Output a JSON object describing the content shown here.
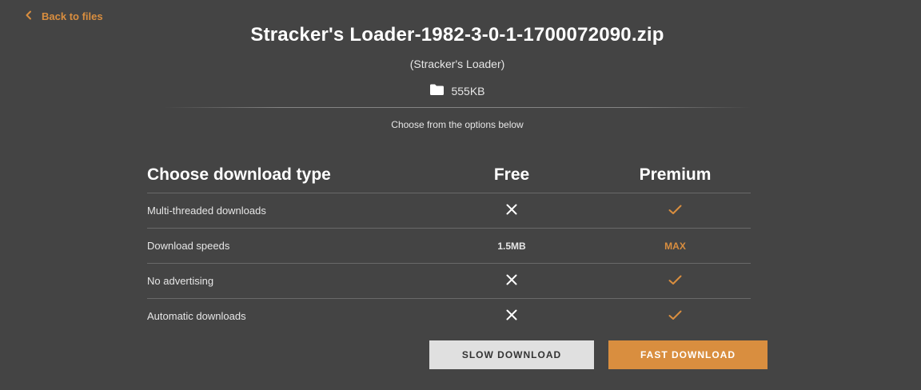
{
  "nav": {
    "back_label": "Back to files"
  },
  "file": {
    "name": "Stracker's Loader-1982-3-0-1-1700072090.zip",
    "mod_name": "(Stracker's Loader)",
    "size": "555KB"
  },
  "options_text": "Choose from the options below",
  "table": {
    "header": {
      "label": "Choose download type",
      "free": "Free",
      "premium": "Premium"
    },
    "rows": [
      {
        "label": "Multi-threaded downloads",
        "free": "x",
        "premium": "check"
      },
      {
        "label": "Download speeds",
        "free": "1.5MB",
        "premium": "MAX"
      },
      {
        "label": "No advertising",
        "free": "x",
        "premium": "check"
      },
      {
        "label": "Automatic downloads",
        "free": "x",
        "premium": "check"
      }
    ]
  },
  "buttons": {
    "slow": "SLOW DOWNLOAD",
    "fast": "FAST DOWNLOAD"
  },
  "icons": {
    "back": "chevron-left-icon",
    "folder": "folder-icon",
    "unavailable": "close-icon",
    "available": "check-icon"
  },
  "colors": {
    "background": "#444444",
    "accent": "#d98e3f",
    "slow_button": "#e0e0e0"
  }
}
